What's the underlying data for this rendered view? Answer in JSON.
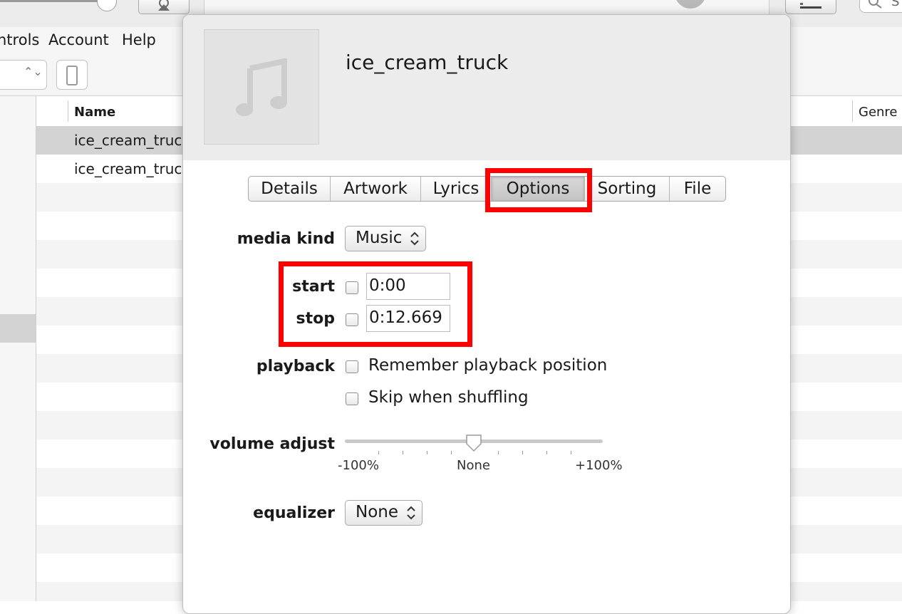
{
  "menu": {
    "controls": "ntrols",
    "account": "Account",
    "help": "Help"
  },
  "search": {
    "partial": "S"
  },
  "list": {
    "columns": {
      "name": "Name",
      "genre": "Genre"
    },
    "rows": [
      "ice_cream_truck",
      "ice_cream_truck"
    ]
  },
  "dialog": {
    "title": "ice_cream_truck",
    "tabs": [
      "Details",
      "Artwork",
      "Lyrics",
      "Options",
      "Sorting",
      "File"
    ],
    "active_tab": "Options",
    "media_kind": {
      "label": "media kind",
      "value": "Music"
    },
    "start": {
      "label": "start",
      "value": "0:00",
      "checked": false
    },
    "stop": {
      "label": "stop",
      "value": "0:12.669",
      "checked": false
    },
    "playback": {
      "label": "playback",
      "remember": "Remember playback position",
      "skip": "Skip when shuffling"
    },
    "volume": {
      "label": "volume adjust",
      "min": "-100%",
      "mid": "None",
      "max": "+100%",
      "value": 0
    },
    "equalizer": {
      "label": "equalizer",
      "value": "None"
    }
  },
  "colors": {
    "highlight": "#ff0000",
    "selected_row": "#d3d3d3",
    "header_bg": "#ececec"
  }
}
